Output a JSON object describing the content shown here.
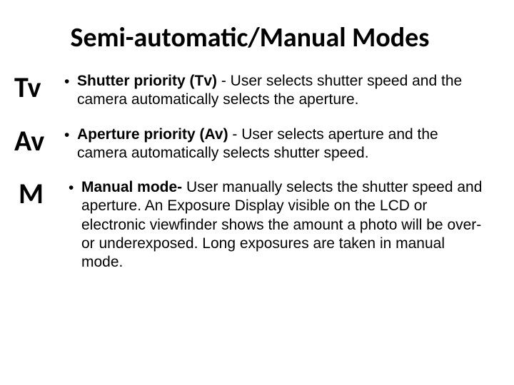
{
  "title": "Semi-automatic/Manual Modes",
  "items": [
    {
      "label": "Tv",
      "bold": "Shutter priority (Tv)",
      "rest": " - User selects shutter speed and the camera automatically selects the aperture."
    },
    {
      "label": "Av",
      "bold": "Aperture priority (Av)",
      "rest": " - User selects aperture and the camera automatically selects shutter speed."
    },
    {
      "label": "M",
      "bold": "Manual mode-",
      "rest": " User manually selects the shutter speed and aperture. An Exposure Display visible on the LCD or electronic viewfinder shows the amount a photo will be over- or underexposed. Long exposures are taken in manual mode."
    }
  ]
}
